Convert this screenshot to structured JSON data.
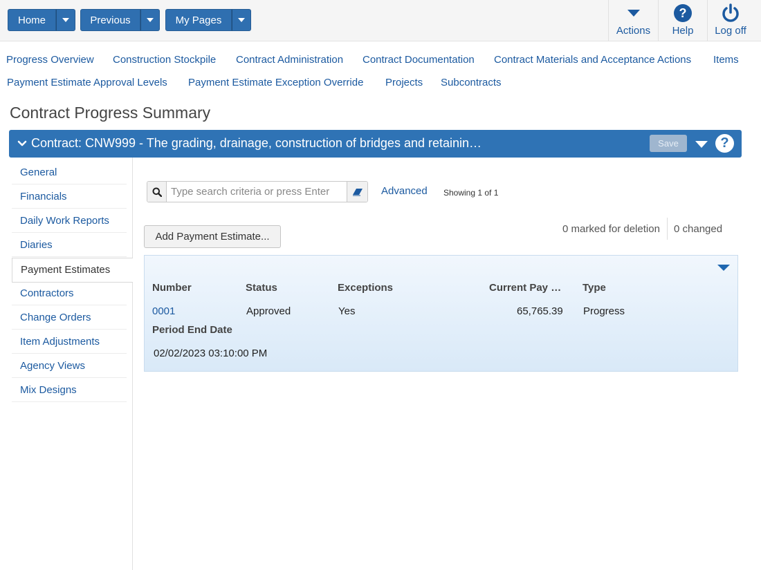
{
  "topbar": {
    "home_label": "Home",
    "previous_label": "Previous",
    "mypages_label": "My Pages",
    "actions_label": "Actions",
    "help_label": "Help",
    "logoff_label": "Log off"
  },
  "nav_links": {
    "row1": [
      "Progress Overview",
      "Construction Stockpile",
      "Contract Administration",
      "Contract Documentation",
      "Contract Materials and Acceptance Actions",
      "Items"
    ],
    "row2": [
      "Payment Estimate Approval Levels",
      "Payment Estimate Exception Override",
      "Projects",
      "Subcontracts"
    ]
  },
  "page": {
    "title": "Contract Progress Summary"
  },
  "contract_bar": {
    "title": "Contract: CNW999 - The grading, drainage, construction of bridges and retainin…",
    "save_label": "Save"
  },
  "sidenav": {
    "items": [
      "General",
      "Financials",
      "Daily Work Reports",
      "Diaries",
      "Payment Estimates",
      "Contractors",
      "Change Orders",
      "Item Adjustments",
      "Agency Views",
      "Mix Designs"
    ],
    "active": "Payment Estimates"
  },
  "search": {
    "placeholder": "Type search criteria or press Enter",
    "value": "",
    "advanced_label": "Advanced",
    "showing_text": "Showing 1 of 1"
  },
  "actions": {
    "add_label": "Add Payment Estimate...",
    "marked_text": "0 marked for deletion",
    "changed_text": "0 changed"
  },
  "result": {
    "headers": {
      "number": "Number",
      "status": "Status",
      "exceptions": "Exceptions",
      "current_pay": "Current Pay …",
      "type": "Type",
      "period_end": "Period End Date"
    },
    "row": {
      "number": "0001",
      "status": "Approved",
      "exceptions": "Yes",
      "current_pay": "65,765.39",
      "type": "Progress",
      "period_end": "02/02/2023 03:10:00 PM"
    }
  },
  "colors": {
    "primary": "#2f73b5",
    "link": "#1c5aa0"
  }
}
